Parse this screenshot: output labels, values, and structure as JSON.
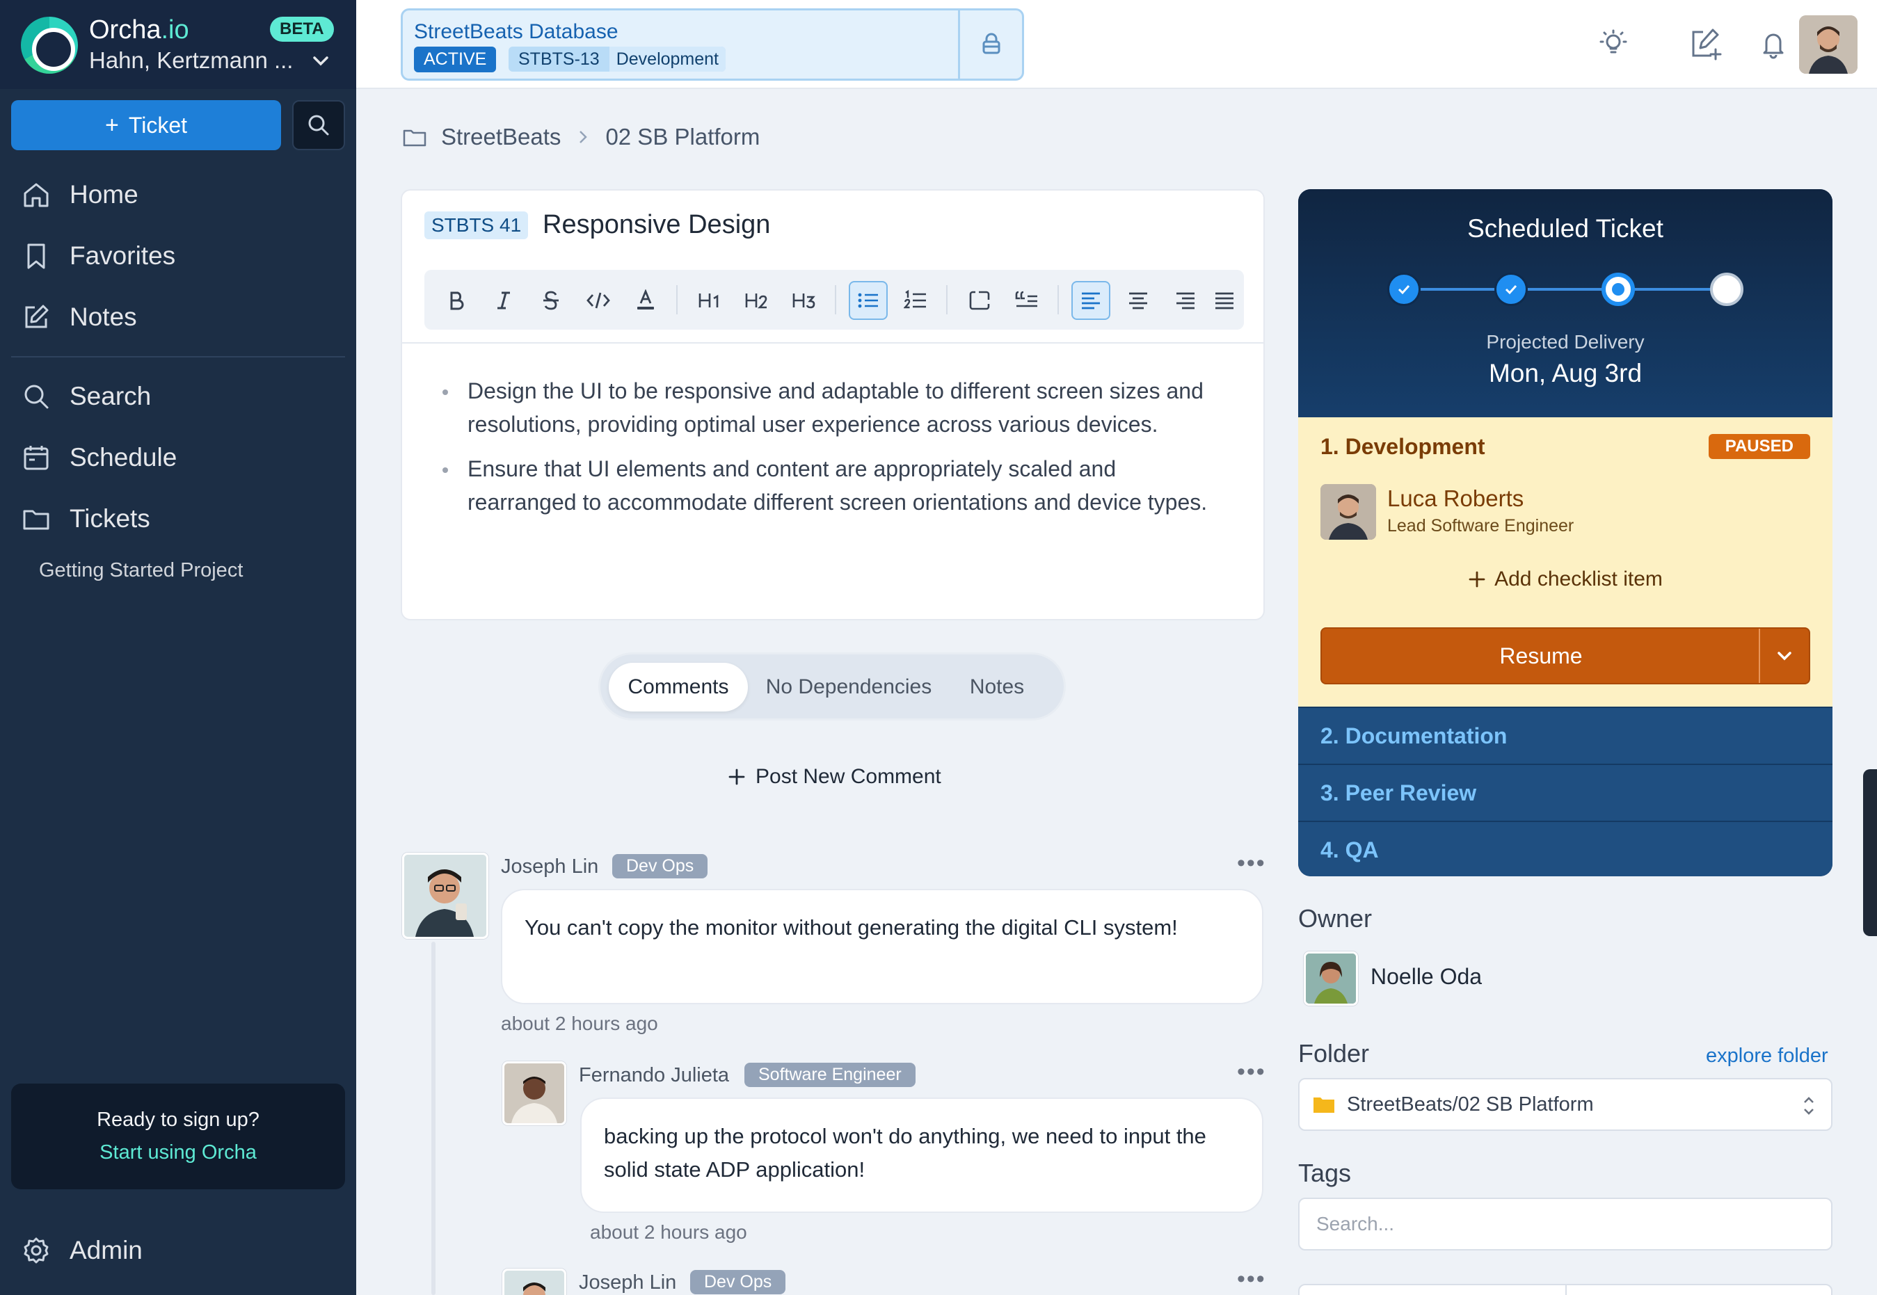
{
  "brand": {
    "name_main": "Orcha",
    "name_suffix": ".io",
    "badge": "BETA",
    "org": "Hahn, Kertzmann ..."
  },
  "sidebar": {
    "new_ticket_label": "Ticket",
    "items": [
      {
        "label": "Home",
        "icon": "home-icon"
      },
      {
        "label": "Favorites",
        "icon": "bookmark-icon"
      },
      {
        "label": "Notes",
        "icon": "edit-icon"
      },
      {
        "label": "Search",
        "icon": "search-icon"
      },
      {
        "label": "Schedule",
        "icon": "calendar-icon"
      },
      {
        "label": "Tickets",
        "icon": "folder-icon"
      }
    ],
    "sub_item": "Getting Started Project",
    "signup_question": "Ready to sign up?",
    "signup_cta": "Start using Orcha",
    "admin_label": "Admin"
  },
  "topbar": {
    "project_name": "StreetBeats Database",
    "status": "ACTIVE",
    "code": "STBTS-13",
    "stage": "Development"
  },
  "breadcrumb": {
    "root": "StreetBeats",
    "current": "02 SB Platform"
  },
  "ticket": {
    "id": "STBTS 41",
    "title": "Responsive Design",
    "bullets": [
      "Design the UI to be responsive and adaptable to different screen sizes and resolutions, providing optimal user experience across various devices.",
      "Ensure that UI elements and content are appropriately scaled and rearranged to accommodate different screen orientations and device types."
    ]
  },
  "toolbar_items": [
    "bold-icon",
    "italic-icon",
    "strikethrough-icon",
    "code-icon",
    "text-color-icon",
    "heading-1-icon",
    "heading-2-icon",
    "heading-3-icon",
    "bullet-list-icon",
    "numbered-list-icon",
    "code-block-icon",
    "blockquote-icon",
    "align-left-icon",
    "align-center-icon",
    "align-right-icon",
    "align-justify-icon"
  ],
  "tabs": {
    "comments": "Comments",
    "dependencies": "No Dependencies",
    "notes": "Notes",
    "active": "Comments"
  },
  "post_comment": "Post New Comment",
  "comments": [
    {
      "author": "Joseph Lin",
      "role": "Dev Ops",
      "text": "You can't copy the monitor without generating the digital CLI system!",
      "time": "about 2 hours ago"
    },
    {
      "author": "Fernando Julieta",
      "role": "Software Engineer",
      "text": "backing up the protocol won't do anything, we need to input the solid state ADP application!",
      "time": "about 2 hours ago"
    },
    {
      "author": "Joseph Lin",
      "role": "Dev Ops"
    }
  ],
  "schedule": {
    "title": "Scheduled Ticket",
    "projected_label": "Projected Delivery",
    "projected_date": "Mon, Aug 3rd",
    "steps": [
      "done",
      "done",
      "current",
      "todo"
    ],
    "current_stage": {
      "name": "1. Development",
      "status": "PAUSED",
      "assignee_name": "Luca Roberts",
      "assignee_role": "Lead Software Engineer",
      "add_checklist": "Add checklist item",
      "resume_label": "Resume"
    },
    "other_stages": [
      "2. Documentation",
      "3. Peer Review",
      "4. QA"
    ]
  },
  "details": {
    "owner_label": "Owner",
    "owner_name": "Noelle Oda",
    "folder_label": "Folder",
    "explore_folder": "explore folder",
    "folder_value": "StreetBeats/02 SB Platform",
    "tags_label": "Tags",
    "tags_placeholder": "Search..."
  },
  "colors": {
    "sidebar": "#1c2e45",
    "accent": "#1e7fd8",
    "teal": "#5eead4",
    "paused": "#d9690e",
    "resume": "#c4590d"
  }
}
